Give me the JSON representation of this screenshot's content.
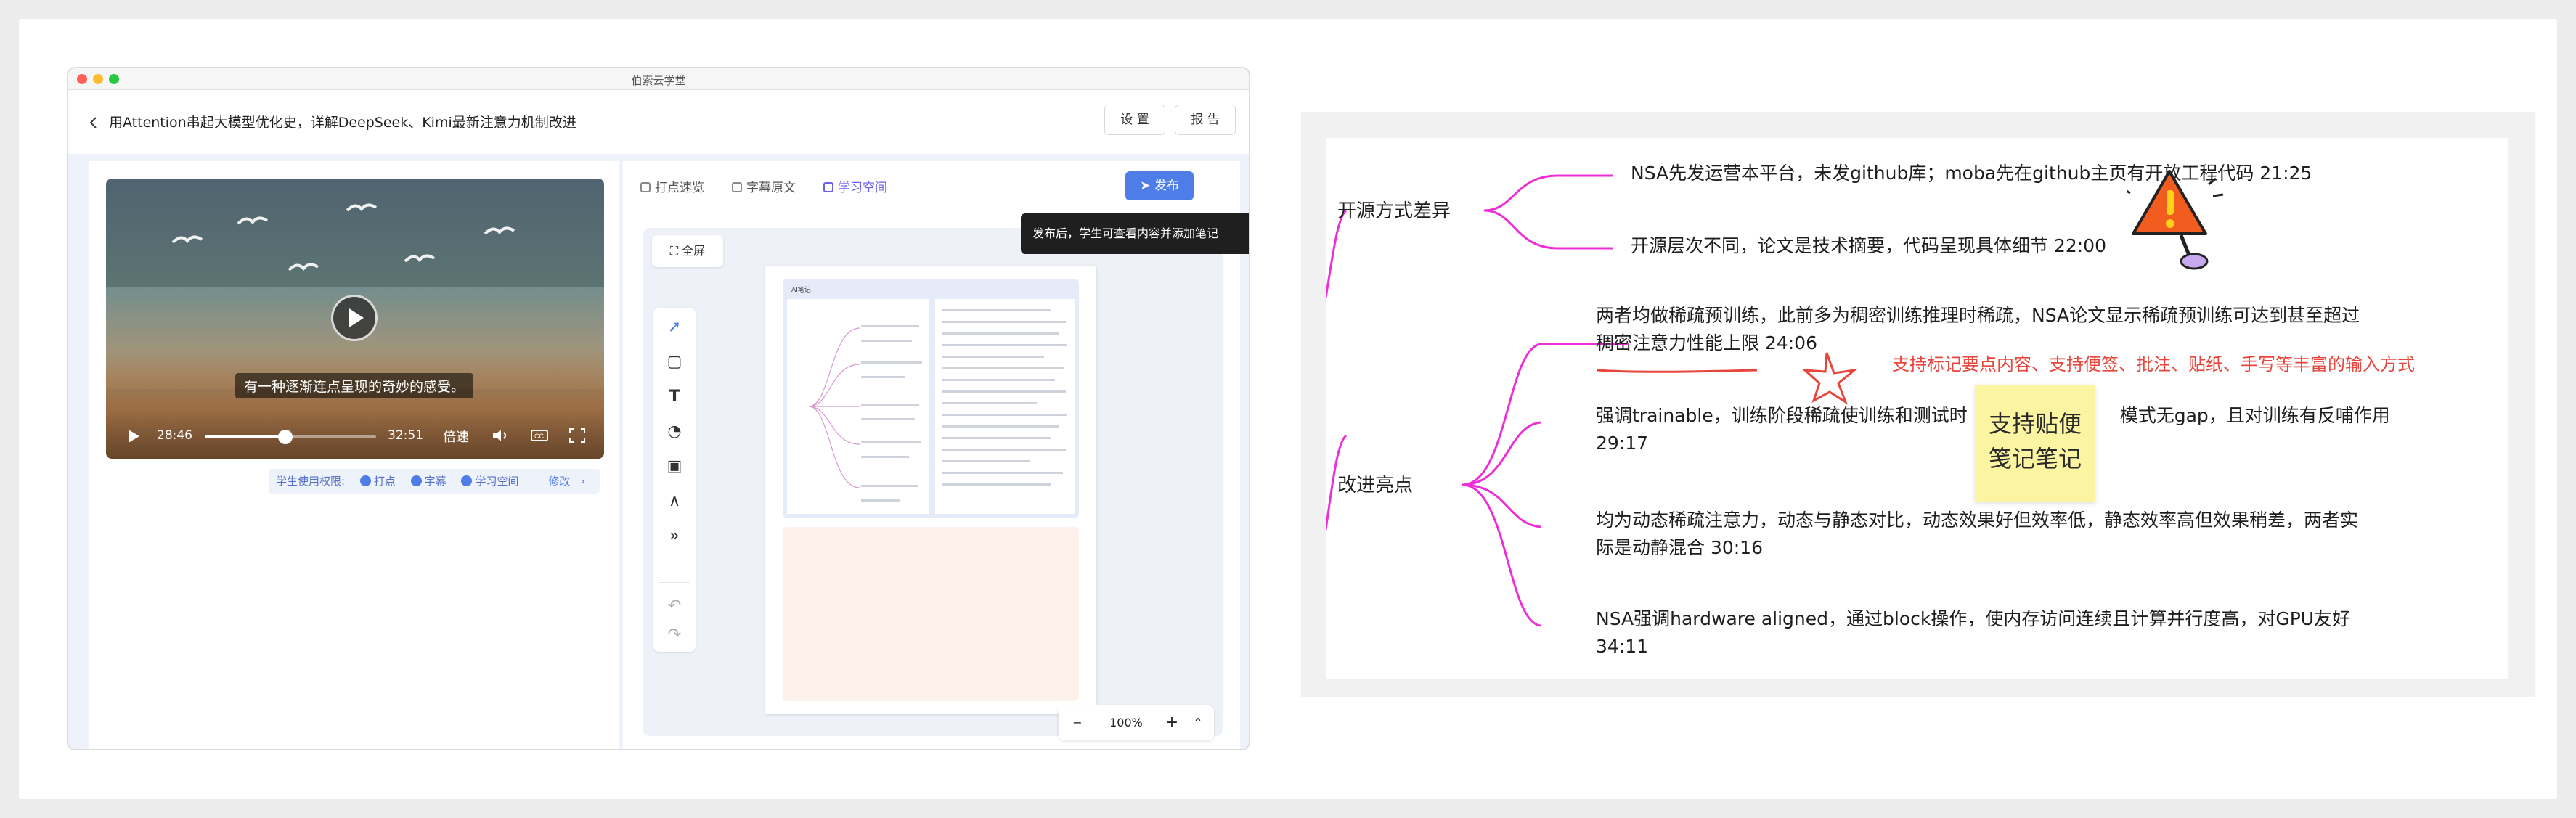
{
  "app": {
    "window_title": "伯索云学堂",
    "page_title": "用Attention串起大模型优化史，详解DeepSeek、Kimi最新注意力机制改进",
    "settings_label": "设 置",
    "report_label": "报 告"
  },
  "video": {
    "subtitle": "有一种逐渐连点呈现的奇妙的感受。",
    "current_time": "28:46",
    "total_time": "32:51",
    "speed_label": "倍速",
    "progress": 0.47
  },
  "permissions": {
    "label": "学生使用权限:",
    "items": [
      "打点",
      "字幕",
      "学习空间"
    ],
    "edit_label": "修改"
  },
  "right_pane": {
    "tabs": [
      "打点速览",
      "字幕原文",
      "学习空间"
    ],
    "publish_label": "发布",
    "tooltip": "发布后，学生可查看内容并添加笔记",
    "fullscreen_label": "全屏",
    "zoom_label": "100%",
    "mini_header": "AI笔记"
  },
  "mindmap": {
    "l1_top": "开源方式差异",
    "l1_bottom": "改进亮点",
    "top_items": [
      "NSA先发运营本平台，未发github库；moba先在github主页有",
      "开放工程代码 21:25",
      "开源层次不同，论文是技术摘要，代码呈现具体细节 22:00"
    ],
    "bottom_items": [
      "两者均做稀疏预训练，此前多为稠密训练推理时稀疏，NSA论文显示稀疏预训练可达到甚至超过",
      "稠密注意力性能上限 24:06",
      "强调trainable，训练阶段稀疏使训练和测试时",
      "模式无gap，且对训练有反哺作用",
      "29:17",
      "均为动态稀疏注意力，动态与静态对比，动态效果好但效率低，静态效率高但效果稍差，两者实",
      "际是动静混合 30:16",
      "NSA强调hardware aligned，通过block操作，使内存访问连续且计算并行度高，对GPU友好",
      "34:11"
    ],
    "annotation": "支持标记要点内容、支持便签、批注、贴纸、手写等丰富的输入方式",
    "sticky_line1": "支持贴便",
    "sticky_line2": "笺记笔记"
  },
  "colors": {
    "accent": "#4f7de8",
    "mindmap_branch": "#ee2fd8",
    "annotation_red": "#e8453c",
    "sticky_yellow": "#fbf5a2"
  }
}
